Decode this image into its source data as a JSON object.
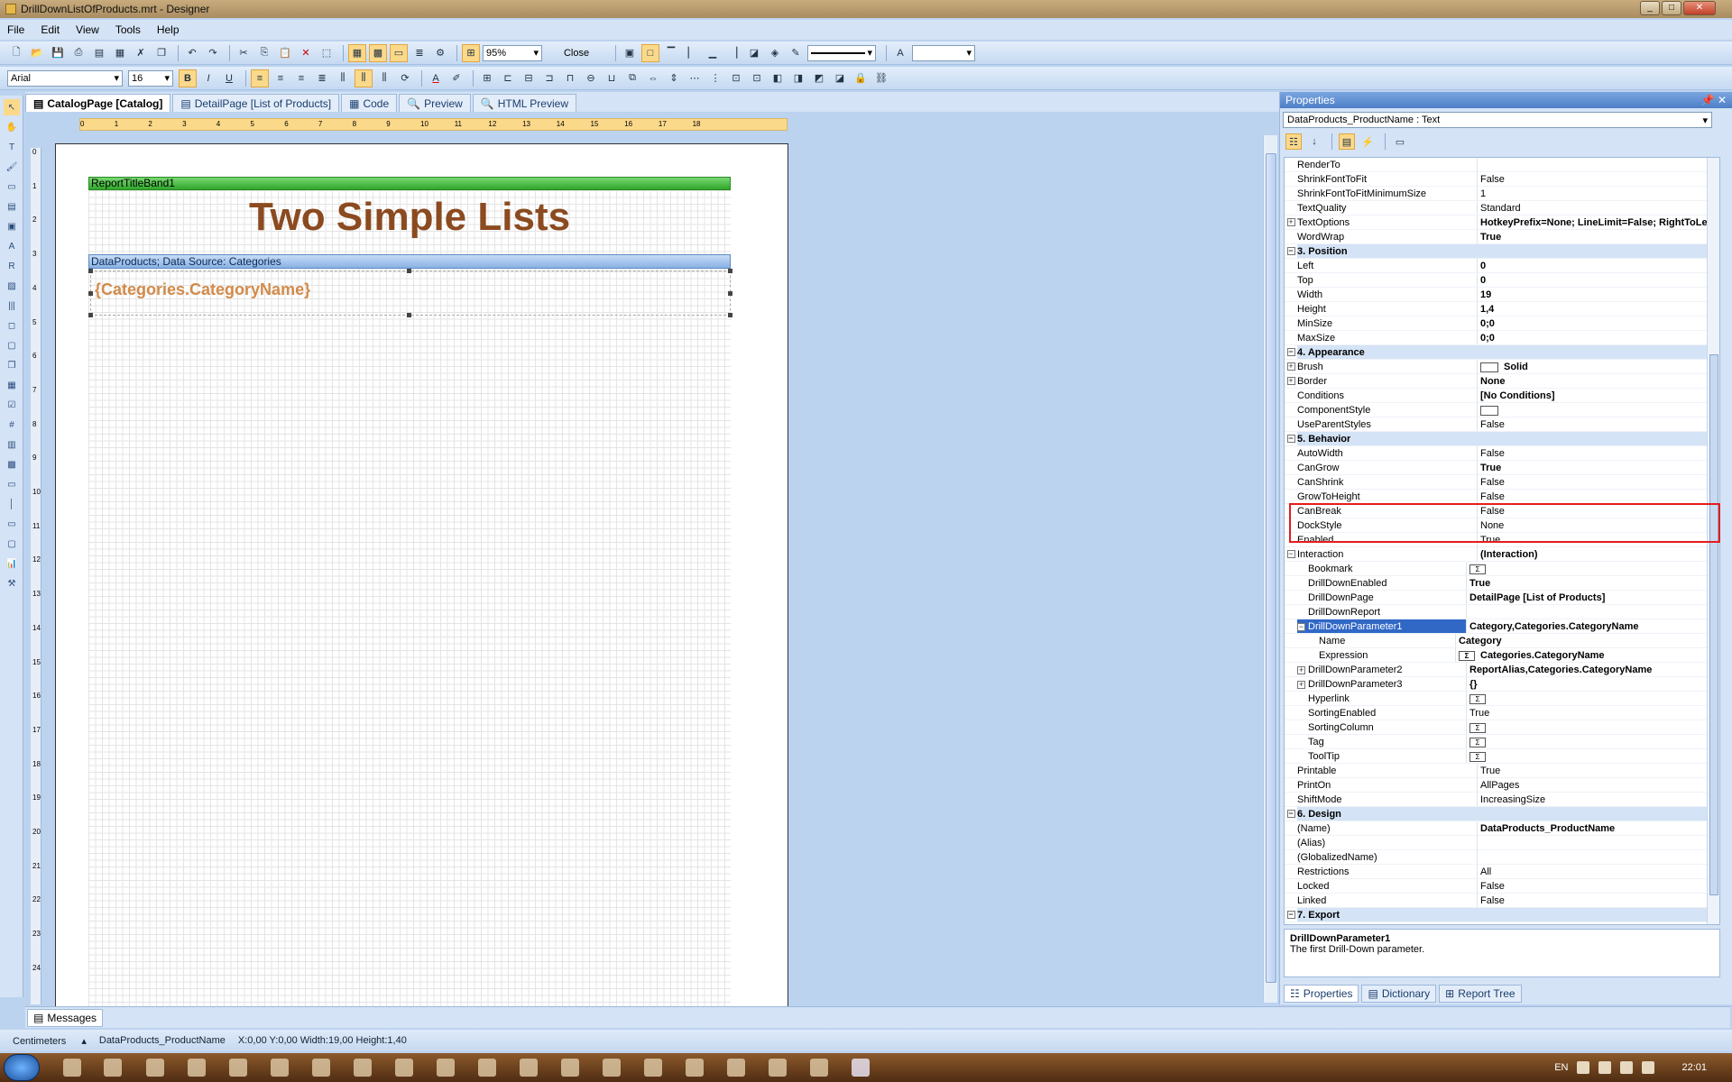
{
  "window": {
    "title": "DrillDownListOfProducts.mrt - Designer"
  },
  "menu": [
    "File",
    "Edit",
    "View",
    "Tools",
    "Help"
  ],
  "toolbar1": {
    "zoom": "95%",
    "close_label": "Close"
  },
  "toolbar2": {
    "font": "Arial",
    "size": "16"
  },
  "tabs": [
    {
      "label": "CatalogPage [Catalog]",
      "selected": true
    },
    {
      "label": "DetailPage [List of Products]",
      "selected": false
    },
    {
      "label": "Code",
      "selected": false
    },
    {
      "label": "Preview",
      "selected": false
    },
    {
      "label": "HTML Preview",
      "selected": false
    }
  ],
  "ruler_h": [
    "0",
    "1",
    "2",
    "3",
    "4",
    "5",
    "6",
    "7",
    "8",
    "9",
    "10",
    "11",
    "12",
    "13",
    "14",
    "15",
    "16",
    "17",
    "18"
  ],
  "ruler_v": [
    "0",
    "1",
    "2",
    "3",
    "4",
    "5",
    "6",
    "7",
    "8",
    "9",
    "10",
    "11",
    "12",
    "13",
    "14",
    "15",
    "16",
    "17",
    "18",
    "19",
    "20",
    "21",
    "22",
    "23",
    "24"
  ],
  "report": {
    "title_band": "ReportTitleBand1",
    "title_text": "Two Simple Lists",
    "data_band": "DataProducts; Data Source: Categories",
    "field_text": "{Categories.CategoryName}"
  },
  "properties": {
    "header": "Properties",
    "object": "DataProducts_ProductName : Text",
    "rows": [
      {
        "name": "RenderTo",
        "value": "",
        "indent": 0
      },
      {
        "name": "ShrinkFontToFit",
        "value": "False",
        "indent": 0
      },
      {
        "name": "ShrinkFontToFitMinimumSize",
        "value": "1",
        "indent": 0
      },
      {
        "name": "TextQuality",
        "value": "Standard",
        "indent": 0
      },
      {
        "name": "TextOptions",
        "value": "HotkeyPrefix=None; LineLimit=False; RightToLe",
        "indent": 0,
        "exp": "+",
        "bold": true
      },
      {
        "name": "WordWrap",
        "value": "True",
        "indent": 0,
        "bold": true
      },
      {
        "cat": "3. Position"
      },
      {
        "name": "Left",
        "value": "0",
        "indent": 0,
        "bold": true
      },
      {
        "name": "Top",
        "value": "0",
        "indent": 0,
        "bold": true
      },
      {
        "name": "Width",
        "value": "19",
        "indent": 0,
        "bold": true
      },
      {
        "name": "Height",
        "value": "1,4",
        "indent": 0,
        "bold": true
      },
      {
        "name": "MinSize",
        "value": "0;0",
        "indent": 0,
        "bold": true
      },
      {
        "name": "MaxSize",
        "value": "0;0",
        "indent": 0,
        "bold": true
      },
      {
        "cat": "4. Appearance"
      },
      {
        "name": "Brush",
        "value": "Solid",
        "indent": 0,
        "exp": "+",
        "bold": true,
        "swatch": true
      },
      {
        "name": "Border",
        "value": "None",
        "indent": 0,
        "exp": "+",
        "bold": true
      },
      {
        "name": "Conditions",
        "value": "[No Conditions]",
        "indent": 0,
        "bold": true
      },
      {
        "name": "ComponentStyle",
        "value": "",
        "indent": 0,
        "swatch": true
      },
      {
        "name": "UseParentStyles",
        "value": "False",
        "indent": 0
      },
      {
        "cat": "5. Behavior"
      },
      {
        "name": "AutoWidth",
        "value": "False",
        "indent": 0
      },
      {
        "name": "CanGrow",
        "value": "True",
        "indent": 0,
        "bold": true
      },
      {
        "name": "CanShrink",
        "value": "False",
        "indent": 0
      },
      {
        "name": "GrowToHeight",
        "value": "False",
        "indent": 0
      },
      {
        "name": "CanBreak",
        "value": "False",
        "indent": 0
      },
      {
        "name": "DockStyle",
        "value": "None",
        "indent": 0
      },
      {
        "name": "Enabled",
        "value": "True",
        "indent": 0
      },
      {
        "name": "Interaction",
        "value": "(Interaction)",
        "indent": 0,
        "exp": "−",
        "bold": true
      },
      {
        "name": "Bookmark",
        "value": "",
        "indent": 1,
        "btn": true
      },
      {
        "name": "DrillDownEnabled",
        "value": "True",
        "indent": 1,
        "bold": true
      },
      {
        "name": "DrillDownPage",
        "value": "DetailPage [List of Products]",
        "indent": 1,
        "bold": true
      },
      {
        "name": "DrillDownReport",
        "value": "",
        "indent": 1
      },
      {
        "name": "DrillDownParameter1",
        "value": "Category,Categories.CategoryName",
        "indent": 1,
        "exp": "−",
        "sel": true
      },
      {
        "name": "Name",
        "value": "Category",
        "indent": 2,
        "bold": true
      },
      {
        "name": "Expression",
        "value": "Categories.CategoryName",
        "indent": 2,
        "bold": true,
        "btn": true
      },
      {
        "name": "DrillDownParameter2",
        "value": "ReportAlias,Categories.CategoryName",
        "indent": 1,
        "exp": "+",
        "bold": true
      },
      {
        "name": "DrillDownParameter3",
        "value": "{}",
        "indent": 1,
        "exp": "+",
        "bold": true
      },
      {
        "name": "Hyperlink",
        "value": "",
        "indent": 1,
        "btn": true
      },
      {
        "name": "SortingEnabled",
        "value": "True",
        "indent": 1
      },
      {
        "name": "SortingColumn",
        "value": "",
        "indent": 1,
        "btn": true
      },
      {
        "name": "Tag",
        "value": "",
        "indent": 1,
        "btn": true
      },
      {
        "name": "ToolTip",
        "value": "",
        "indent": 1,
        "btn": true
      },
      {
        "name": "Printable",
        "value": "True",
        "indent": 0
      },
      {
        "name": "PrintOn",
        "value": "AllPages",
        "indent": 0
      },
      {
        "name": "ShiftMode",
        "value": "IncreasingSize",
        "indent": 0
      },
      {
        "cat": "6. Design"
      },
      {
        "name": "(Name)",
        "value": "DataProducts_ProductName",
        "indent": 0,
        "bold": true
      },
      {
        "name": "(Alias)",
        "value": "",
        "indent": 0
      },
      {
        "name": "(GlobalizedName)",
        "value": "",
        "indent": 0
      },
      {
        "name": "Restrictions",
        "value": "All",
        "indent": 0
      },
      {
        "name": "Locked",
        "value": "False",
        "indent": 0
      },
      {
        "name": "Linked",
        "value": "False",
        "indent": 0
      },
      {
        "cat": "7. Export"
      }
    ],
    "desc_title": "DrillDownParameter1",
    "desc_text": "The first Drill-Down parameter.",
    "bottom_tabs": [
      "Properties",
      "Dictionary",
      "Report Tree"
    ]
  },
  "messages_tab": "Messages",
  "status": {
    "units": "Centimeters",
    "component": "DataProducts_ProductName",
    "coords": "X:0,00  Y:0,00  Width:19,00  Height:1,40"
  },
  "tray": {
    "lang": "EN",
    "time": "22:01"
  },
  "colors": {
    "title_text": "#8b4a1f",
    "field_text": "#d28b4a",
    "selection": "#3168c6",
    "highlight_box": "#e51c1c",
    "title_band": "#2fa62a",
    "data_band": "#89b1e4"
  }
}
